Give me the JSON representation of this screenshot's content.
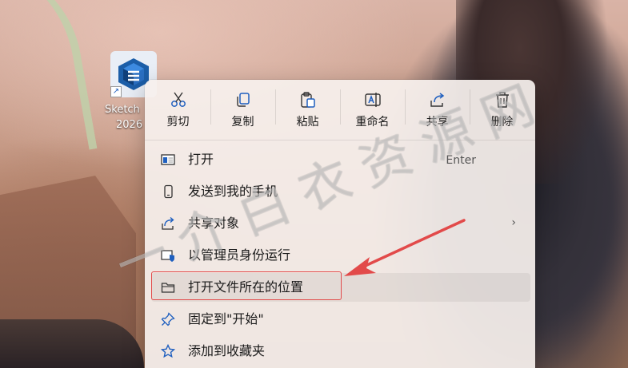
{
  "desktop": {
    "icon_label_line1": "Sketch",
    "icon_label_line2": "2026"
  },
  "quick_actions": [
    {
      "label": "剪切",
      "icon": "scissors-icon"
    },
    {
      "label": "复制",
      "icon": "copy-icon"
    },
    {
      "label": "粘贴",
      "icon": "paste-icon"
    },
    {
      "label": "重命名",
      "icon": "rename-icon"
    },
    {
      "label": "共享",
      "icon": "share-icon"
    },
    {
      "label": "删除",
      "icon": "trash-icon"
    }
  ],
  "menu_items": [
    {
      "label": "打开",
      "shortcut": "Enter",
      "icon": "open-window-icon"
    },
    {
      "label": "发送到我的手机",
      "icon": "phone-icon"
    },
    {
      "label": "共享对象",
      "icon": "share-object-icon",
      "has_submenu": true
    },
    {
      "label": "以管理员身份运行",
      "icon": "admin-shield-icon"
    },
    {
      "label": "打开文件所在的位置",
      "icon": "folder-icon",
      "highlighted": true
    },
    {
      "label": "固定到\"开始\"",
      "icon": "pin-icon"
    },
    {
      "label": "添加到收藏夹",
      "icon": "star-icon"
    }
  ],
  "watermark": "一介白衣资源网",
  "colors": {
    "highlight_border": "#e24a4a",
    "accent": "#1f5fbf"
  }
}
